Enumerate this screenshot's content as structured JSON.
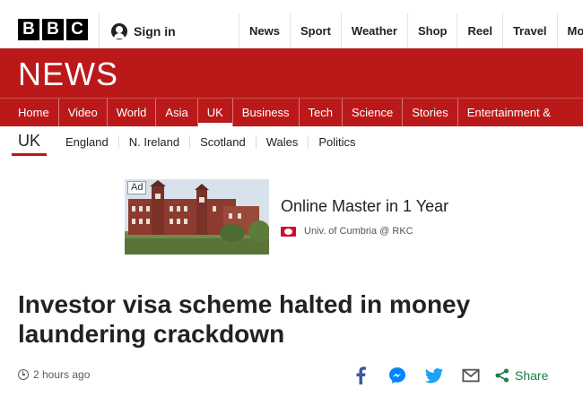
{
  "header": {
    "logo_letters": [
      "B",
      "B",
      "C"
    ],
    "signin_label": "Sign in",
    "top_nav": [
      "News",
      "Sport",
      "Weather",
      "Shop",
      "Reel",
      "Travel",
      "Mor"
    ]
  },
  "news_bar": {
    "title": "NEWS",
    "main_nav": [
      "Home",
      "Video",
      "World",
      "Asia",
      "UK",
      "Business",
      "Tech",
      "Science",
      "Stories",
      "Entertainment &"
    ],
    "active_item": "UK"
  },
  "sub_nav": {
    "current": "UK",
    "items": [
      "England",
      "N. Ireland",
      "Scotland",
      "Wales",
      "Politics"
    ]
  },
  "ad": {
    "label": "Ad",
    "title": "Online Master in 1 Year",
    "advertiser": "Univ. of Cumbria @ RKC"
  },
  "article": {
    "headline": "Investor visa scheme halted in money laundering crackdown",
    "timestamp": "2 hours ago"
  },
  "share": {
    "icons": [
      "facebook-icon",
      "messenger-icon",
      "twitter-icon",
      "email-icon",
      "share-icon"
    ],
    "label": "Share"
  },
  "colors": {
    "brand_red": "#bb1919",
    "share_green": "#1e7a44",
    "facebook_blue": "#3b5998",
    "messenger_blue": "#0084ff",
    "twitter_blue": "#1da1f2"
  }
}
